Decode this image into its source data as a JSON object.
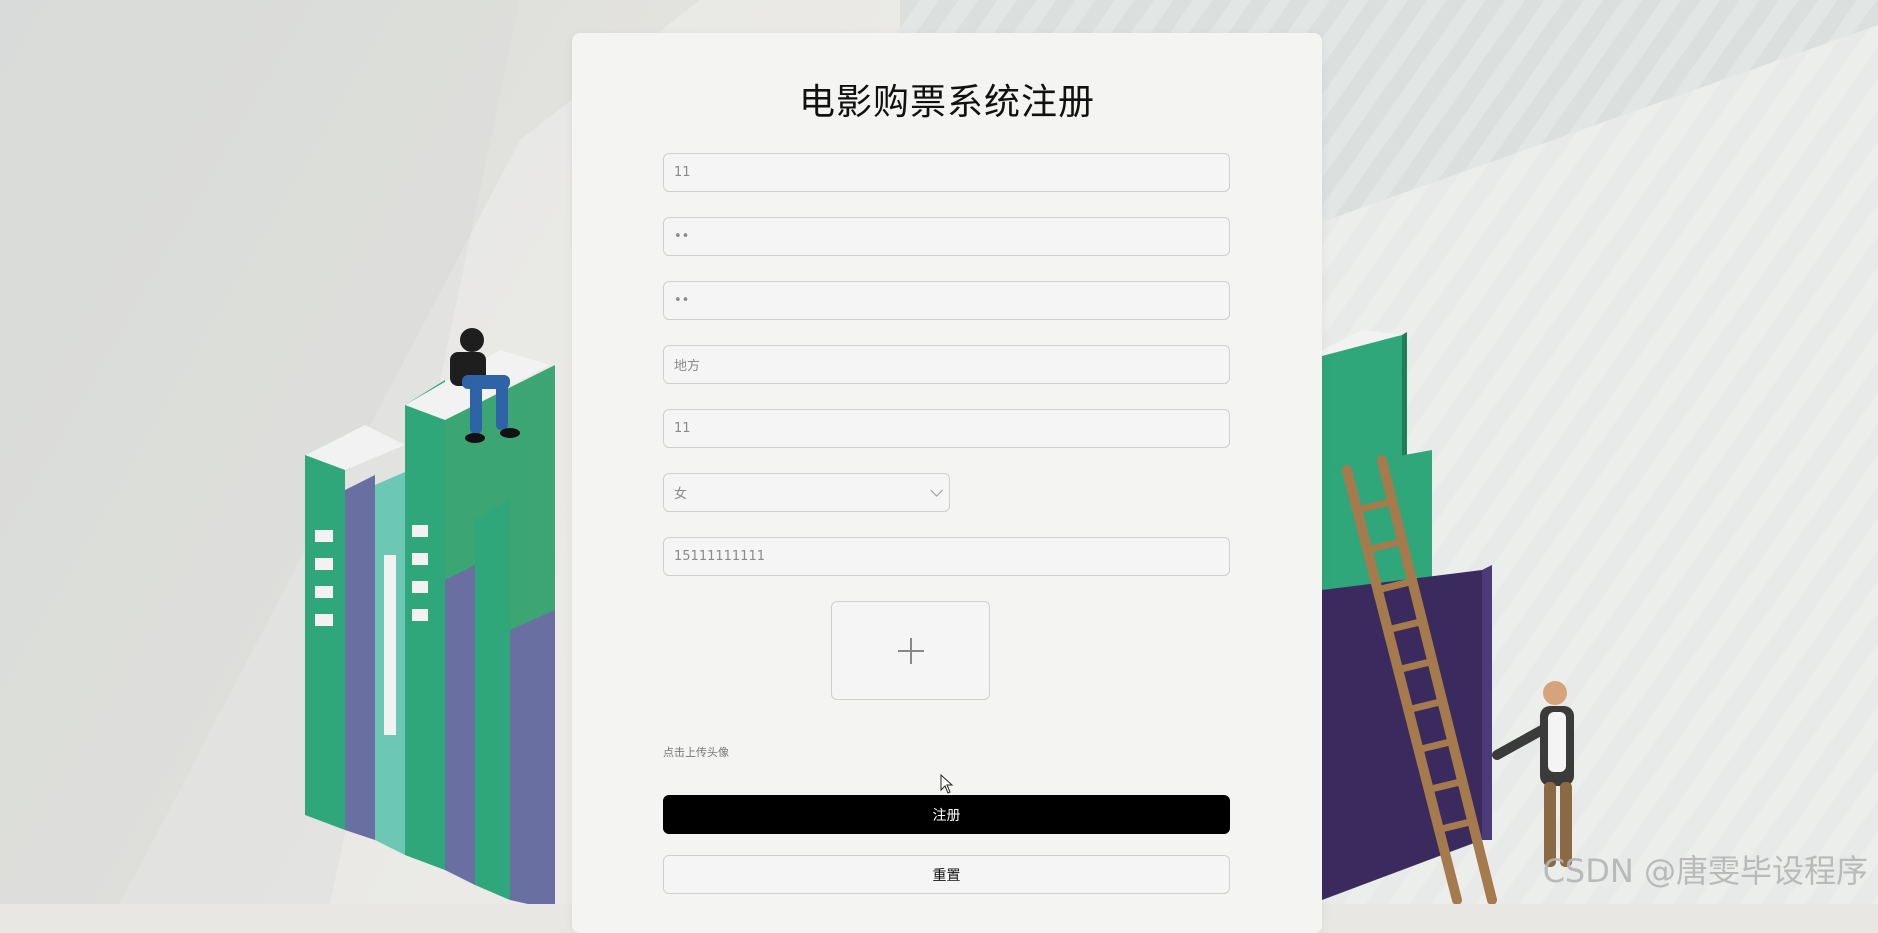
{
  "title": "电影购票系统注册",
  "form": {
    "fields": [
      {
        "value": "11"
      },
      {
        "value": "••"
      },
      {
        "value": "••"
      },
      {
        "value": "地方"
      },
      {
        "value": "11"
      }
    ],
    "gender": {
      "selected": "女"
    },
    "phone": {
      "value": "15111111111"
    },
    "upload": {
      "hint": "点击上传头像",
      "icon": "plus-icon"
    },
    "register_label": "注册",
    "reset_label": "重置"
  },
  "watermark": "CSDN @唐雯毕设程序",
  "colors": {
    "primary_button": "#000000",
    "card_bg": "#f4f4f3"
  }
}
